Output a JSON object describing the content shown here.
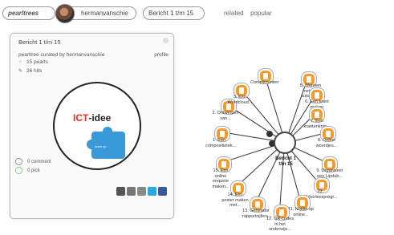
{
  "breadcrumb": {
    "logo": "pearltrees",
    "user": "hermanvanschie",
    "current": "Bericht 1 t/m 15"
  },
  "toplinks": {
    "related": "related",
    "popular": "popular"
  },
  "card": {
    "title": "Bericht 1 t/m 15",
    "curated": "pearltree curated by hermanvanschie",
    "profile": "profile",
    "pearls": "15 pearls",
    "hits": "26 hits",
    "cover_text_a": "ICT",
    "cover_text_b": "-idee",
    "cover_badge": "team up",
    "comments": "0 comment",
    "picks": "0 pick"
  },
  "tree": {
    "root": "Bericht 1 t/m 15",
    "pearls": [
      "Complimenten",
      "5. Wennen met een autocue...",
      "6. Een krant maken",
      "7. Een krantenknip...",
      "8. Online woordjes...",
      "9. Organiseer een Lipdub...",
      "10. Voorleesprogr...",
      "11. Notitie op online...",
      "12. QR-codes in het onderwijs...",
      "13. Generator rapportcijfers...",
      "14. Een poster maken met...",
      "15. Een online enquete maken...",
      "1. Een compositietek...",
      "2. Ontwerpen van...",
      "3. Een Wordcloud..."
    ]
  },
  "colors": {
    "pearl": "#f79a2b",
    "accent": "#3a9ad9"
  }
}
